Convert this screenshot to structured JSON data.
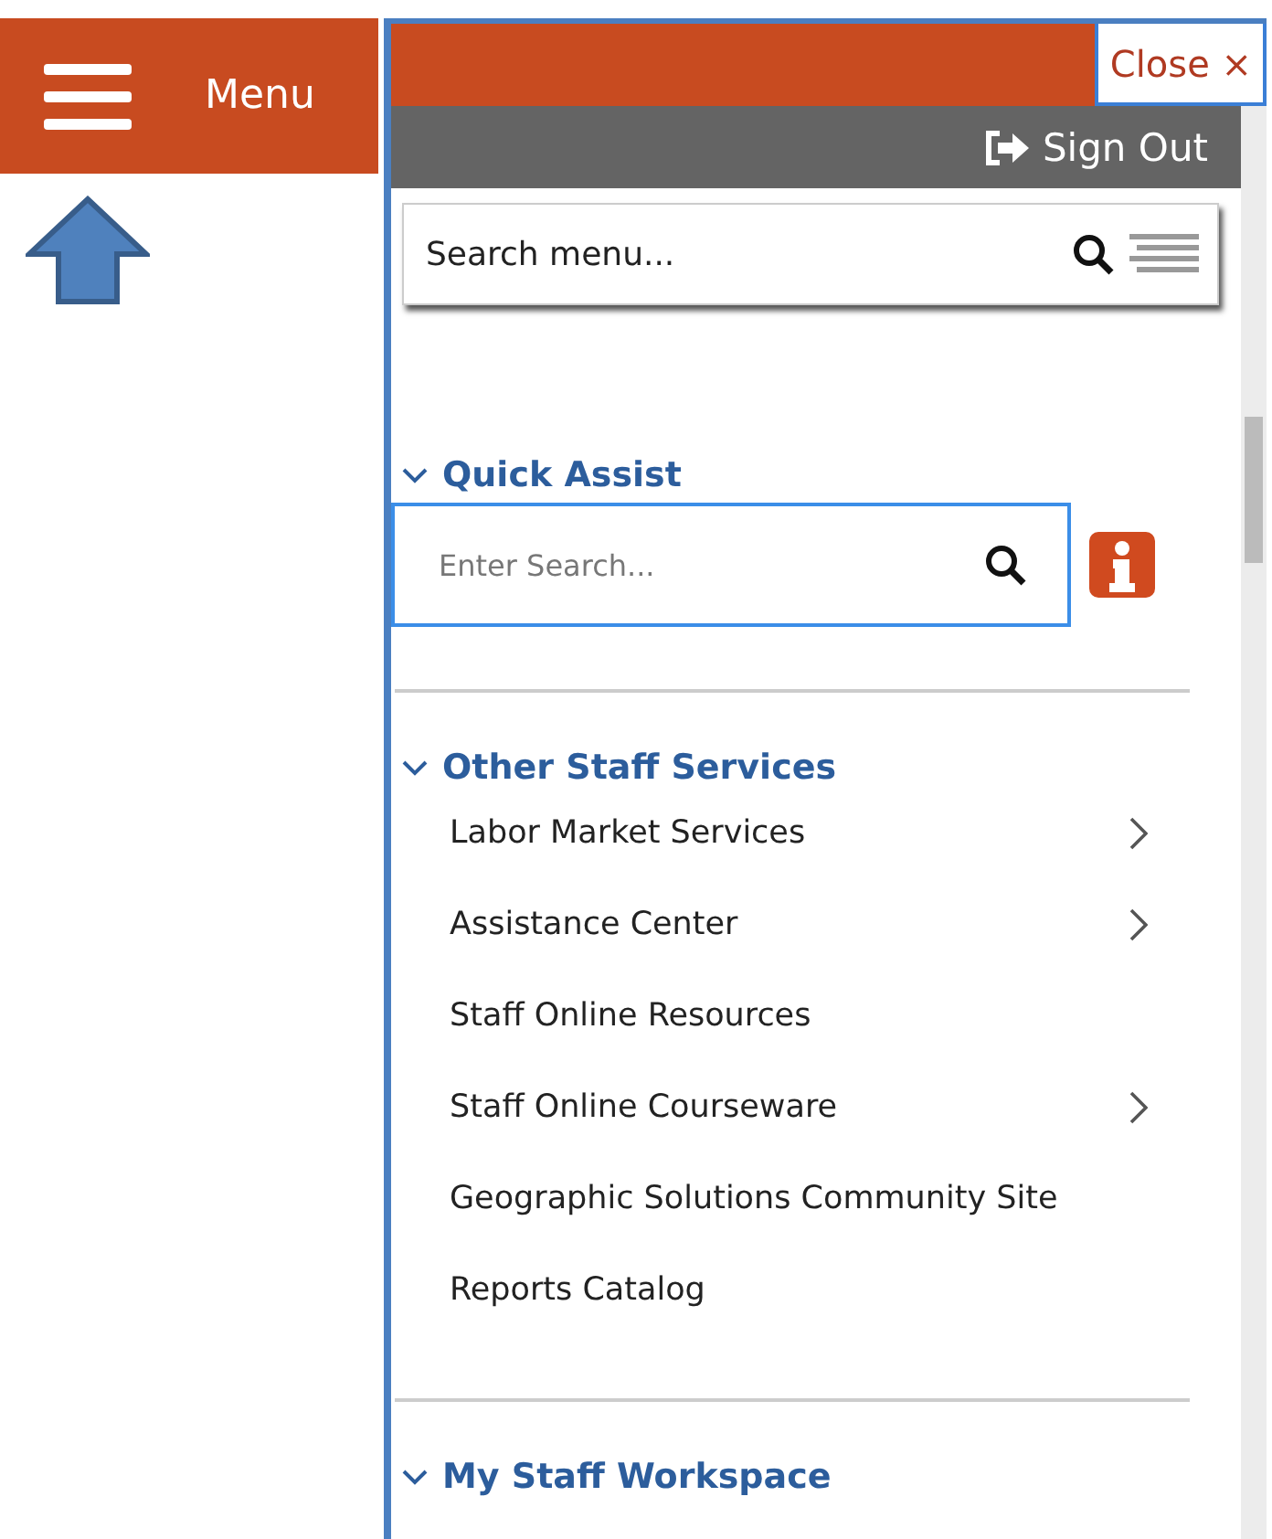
{
  "header": {
    "menu_label": "Menu"
  },
  "panel": {
    "close_label": "Close ×",
    "sign_out_label": "Sign Out",
    "search": {
      "placeholder": "Search menu..."
    }
  },
  "quick_assist": {
    "title": "Quick Assist",
    "expanded": true,
    "search": {
      "placeholder": "Enter Search..."
    }
  },
  "sections": [
    {
      "title": "Other Staff Services",
      "expanded": true,
      "items": [
        {
          "label": "Labor Market Services",
          "has_submenu": true
        },
        {
          "label": "Assistance Center",
          "has_submenu": true
        },
        {
          "label": "Staff Online Resources",
          "has_submenu": false
        },
        {
          "label": "Staff Online Courseware",
          "has_submenu": true
        },
        {
          "label": "Geographic Solutions Community Site",
          "has_submenu": false
        },
        {
          "label": "Reports Catalog",
          "has_submenu": false
        }
      ]
    },
    {
      "title": "My Staff Workspace",
      "expanded": true
    }
  ]
}
